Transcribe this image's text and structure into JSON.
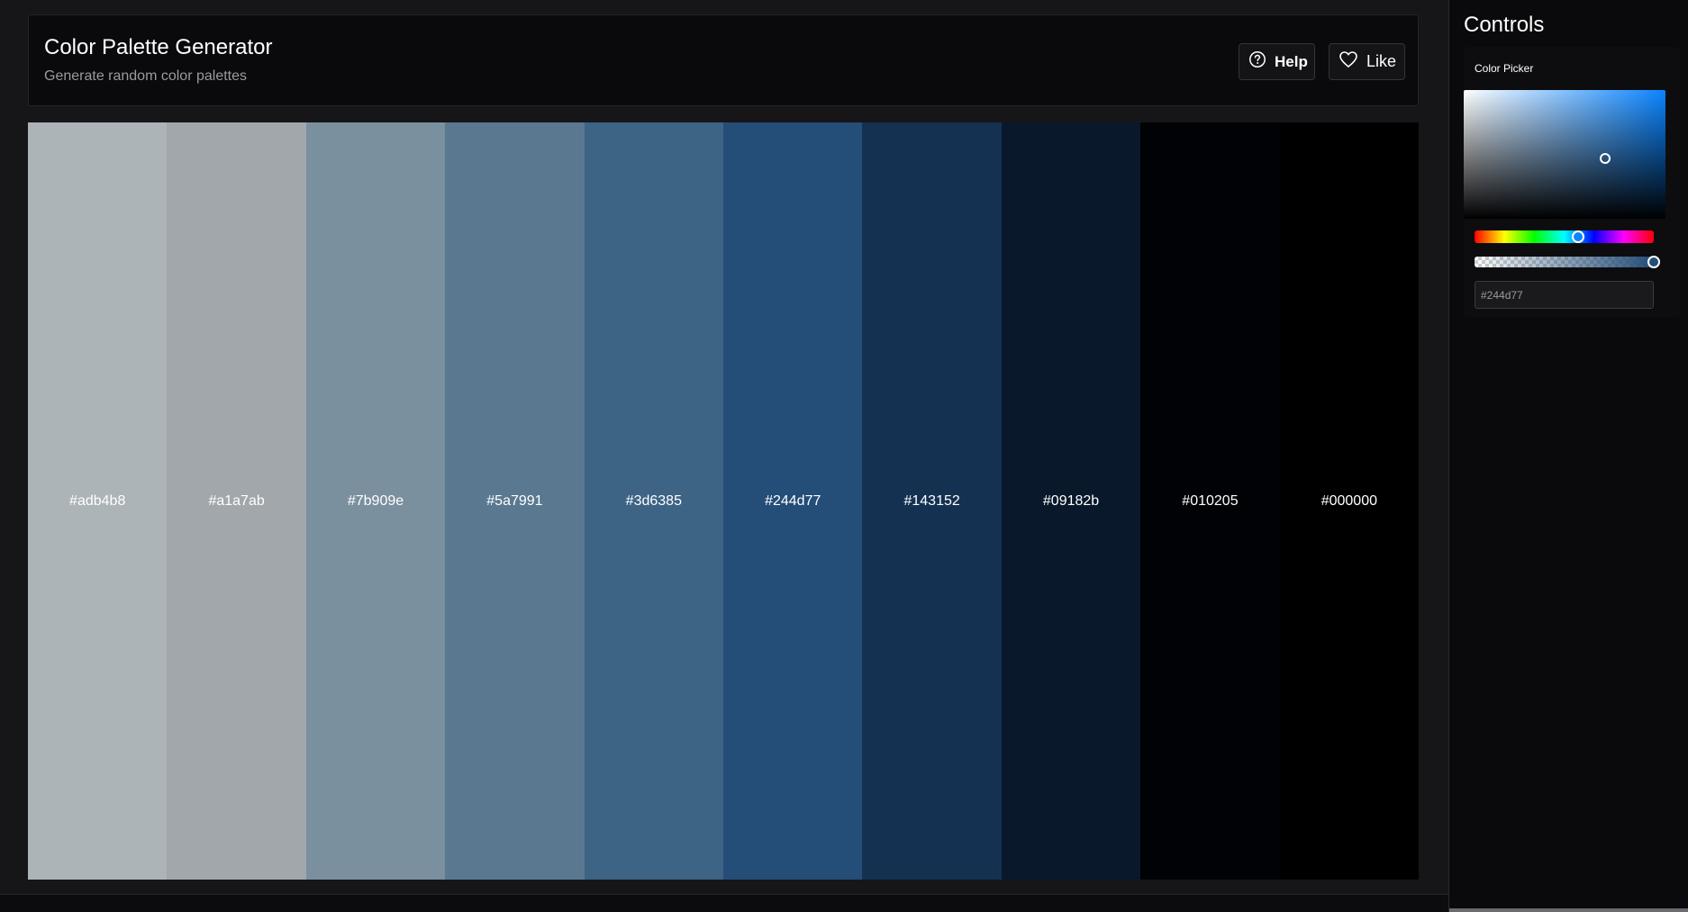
{
  "header": {
    "title": "Color Palette Generator",
    "subtitle": "Generate random color palettes",
    "help_label": "Help",
    "like_label": "Like"
  },
  "palette": [
    {
      "hex": "#adb4b8"
    },
    {
      "hex": "#a1a7ab"
    },
    {
      "hex": "#7b909e"
    },
    {
      "hex": "#5a7991"
    },
    {
      "hex": "#3d6385"
    },
    {
      "hex": "#244d77"
    },
    {
      "hex": "#143152"
    },
    {
      "hex": "#09182b"
    },
    {
      "hex": "#010205"
    },
    {
      "hex": "#000000"
    }
  ],
  "sidebar": {
    "title": "Controls",
    "picker": {
      "label": "Color Picker",
      "hex_value": "#244d77",
      "hue_level": 0.58,
      "alpha_level": 1.0,
      "saturation": 0.7,
      "value": 0.47,
      "hue_color": "#0a84ff"
    }
  },
  "icons": {
    "help": "question-circle-icon",
    "like": "heart-outline-icon"
  }
}
